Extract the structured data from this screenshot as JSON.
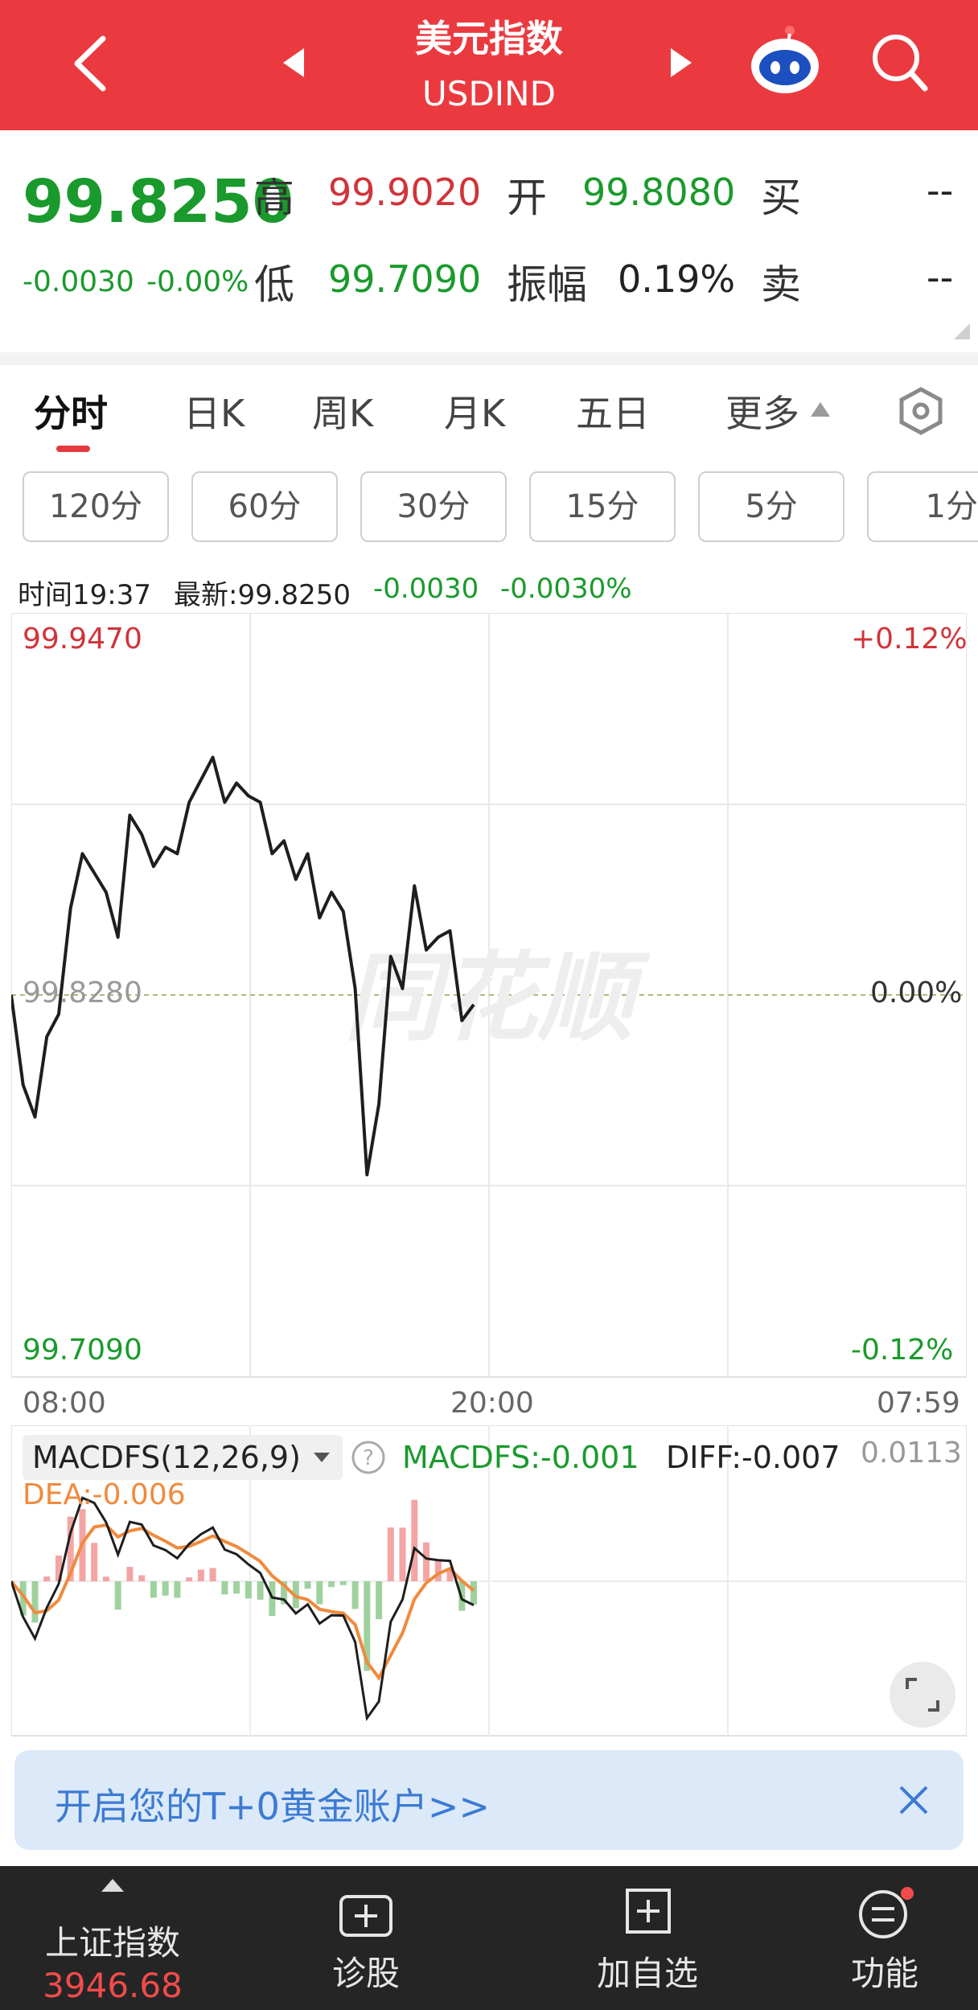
{
  "header": {
    "title": "美元指数",
    "subtitle": "USDIND"
  },
  "quote": {
    "last": "99.8250",
    "change": "-0.0030",
    "change_pct": "-0.00%",
    "high_label": "高",
    "high": "99.9020",
    "open_label": "开",
    "open": "99.8080",
    "buy_label": "买",
    "buy": "--",
    "low_label": "低",
    "low": "99.7090",
    "amplitude_label": "振幅",
    "amplitude": "0.19%",
    "sell_label": "卖",
    "sell": "--"
  },
  "tabs": [
    {
      "label": "分时",
      "active": true
    },
    {
      "label": "日K"
    },
    {
      "label": "周K"
    },
    {
      "label": "月K"
    },
    {
      "label": "五日"
    },
    {
      "label": "更多"
    }
  ],
  "periods": [
    "120分",
    "60分",
    "30分",
    "15分",
    "5分",
    "1分"
  ],
  "infobar": {
    "time": "时间19:37",
    "latest": "最新:99.8250",
    "change": "-0.0030",
    "change_pct": "-0.0030%"
  },
  "intraday": {
    "top_value": "99.9470",
    "top_pct": "+0.12%",
    "mid_value": "99.8280",
    "mid_pct": "0.00%",
    "bottom_value": "99.7090",
    "bottom_pct": "-0.12%",
    "time_start": "08:00",
    "time_mid": "20:00",
    "time_end": "07:59",
    "watermark": "同花顺"
  },
  "macd": {
    "selector": "MACDFS(12,26,9)",
    "macdfs": "MACDFS:-0.001",
    "diff": "DIFF:-0.007",
    "dea": "DEA:-0.006",
    "top_value": "0.0113"
  },
  "chart_data": {
    "type": "line",
    "x_start": "08:00",
    "x_end": "19:37",
    "ylim": [
      99.709,
      99.947
    ],
    "prev_close": 99.828,
    "series": [
      {
        "values": [
          99.828,
          99.8,
          99.79,
          99.815,
          99.822,
          99.855,
          99.872,
          99.866,
          99.86,
          99.846,
          99.884,
          99.878,
          99.868,
          99.874,
          99.872,
          99.888,
          99.895,
          99.902,
          99.888,
          99.894,
          99.89,
          99.888,
          99.872,
          99.876,
          99.864,
          99.872,
          99.852,
          99.86,
          99.854,
          99.83,
          99.772,
          99.794,
          99.84,
          99.83,
          99.862,
          99.842,
          99.846,
          99.848,
          99.82,
          99.825
        ]
      }
    ]
  },
  "banner": {
    "text": "开启您的T+0黄金账户>>"
  },
  "bottom_nav": {
    "index_name": "上证指数",
    "index_value": "3946.68",
    "diagnose": "诊股",
    "add_watch": "加自选",
    "function": "功能"
  },
  "colors": {
    "brand_red": "#ea3a3f",
    "up_red": "#d0343a",
    "down_green": "#1a9a2c"
  }
}
